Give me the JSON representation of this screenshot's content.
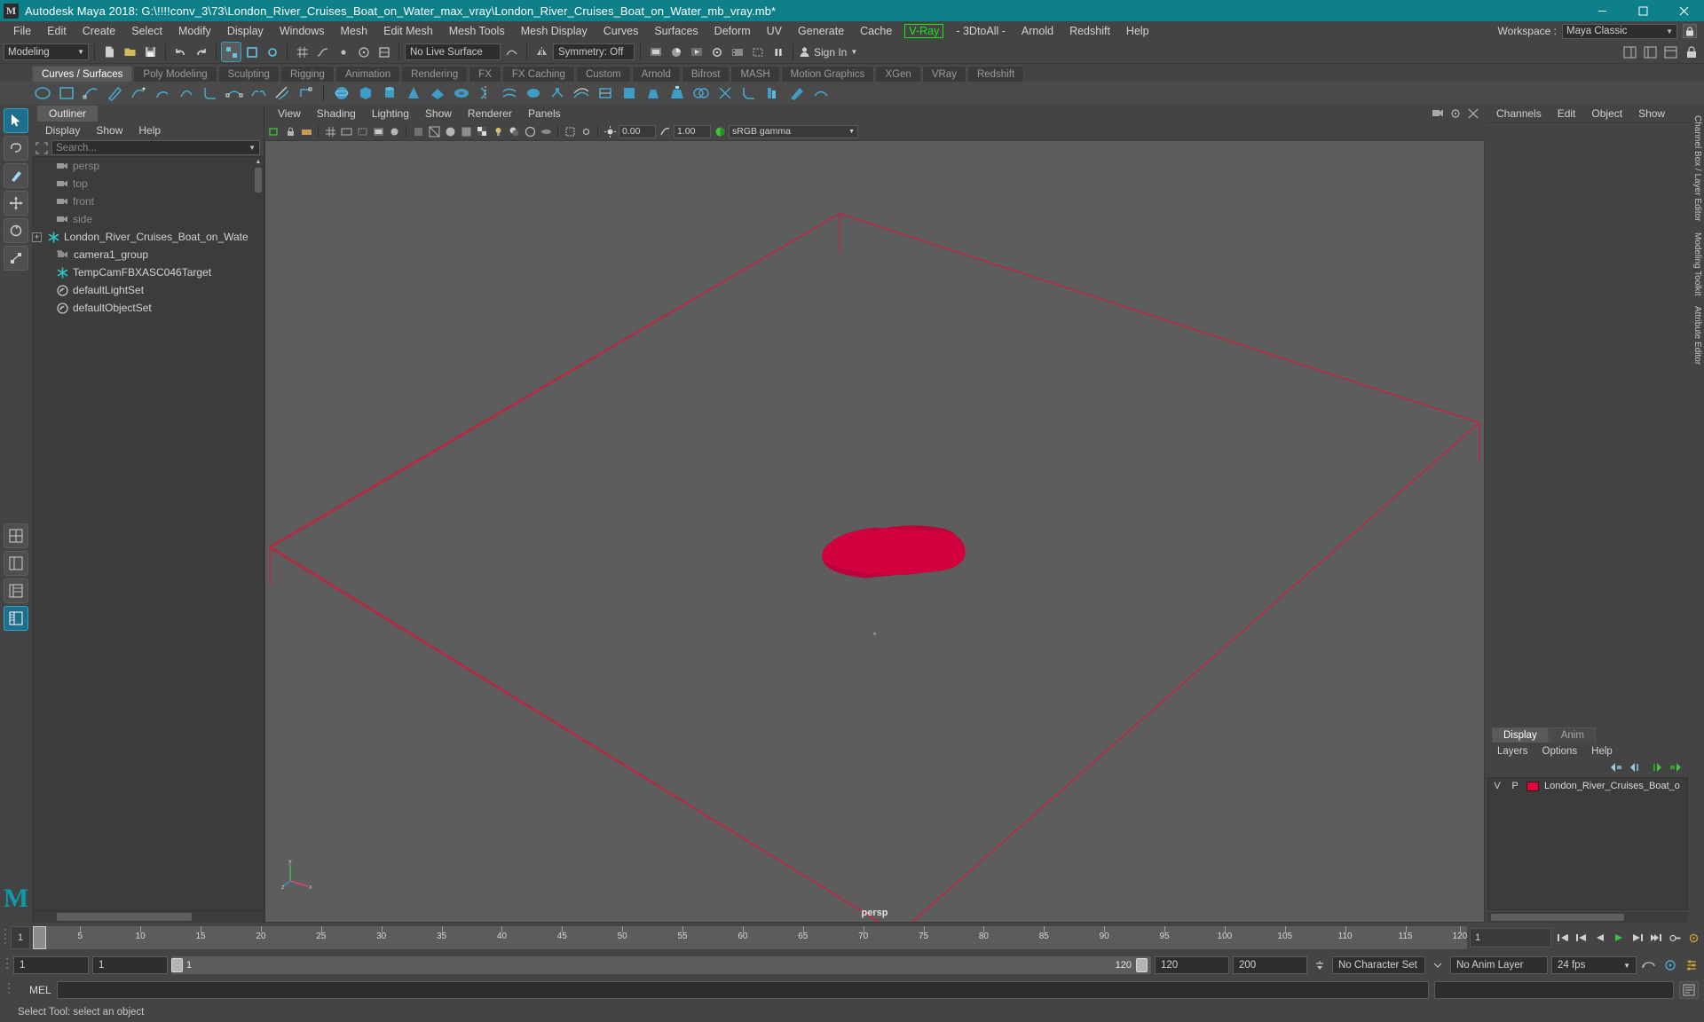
{
  "window": {
    "title": "Autodesk Maya 2018: G:\\!!!!conv_3\\73\\London_River_Cruises_Boat_on_Water_max_vray\\London_River_Cruises_Boat_on_Water_mb_vray.mb*",
    "logo": "M",
    "minimize": "minimize-icon",
    "maximize": "maximize-icon",
    "close": "close-icon"
  },
  "menubar": {
    "items": [
      {
        "label": "File"
      },
      {
        "label": "Edit"
      },
      {
        "label": "Create"
      },
      {
        "label": "Select"
      },
      {
        "label": "Modify"
      },
      {
        "label": "Display"
      },
      {
        "label": "Windows"
      },
      {
        "label": "Mesh"
      },
      {
        "label": "Edit Mesh"
      },
      {
        "label": "Mesh Tools"
      },
      {
        "label": "Mesh Display"
      },
      {
        "label": "Curves"
      },
      {
        "label": "Surfaces"
      },
      {
        "label": "Deform"
      },
      {
        "label": "UV"
      },
      {
        "label": "Generate"
      },
      {
        "label": "Cache"
      },
      {
        "label": "V-Ray"
      },
      {
        "label": "- 3DtoAll -"
      },
      {
        "label": "Arnold"
      },
      {
        "label": "Redshift"
      },
      {
        "label": "Help"
      }
    ],
    "workspace_label": "Workspace :",
    "workspace_value": "Maya Classic",
    "vray_color": "#19e619"
  },
  "statusline": {
    "mode": "Modeling",
    "live_surface": "No Live Surface",
    "symmetry": "Symmetry: Off",
    "signin": "Sign In"
  },
  "shelf": {
    "tabs": [
      "Curves / Surfaces",
      "Poly Modeling",
      "Sculpting",
      "Rigging",
      "Animation",
      "Rendering",
      "FX",
      "FX Caching",
      "Custom",
      "Arnold",
      "Bifrost",
      "MASH",
      "Motion Graphics",
      "XGen",
      "VRay",
      "Redshift"
    ],
    "active_tab": "Curves / Surfaces"
  },
  "outliner": {
    "tab": "Outliner",
    "menus": [
      "Display",
      "Show",
      "Help"
    ],
    "search_placeholder": "Search...",
    "items": [
      {
        "label": "persp",
        "icon": "camera-icon",
        "dim": true,
        "expandable": false
      },
      {
        "label": "top",
        "icon": "camera-icon",
        "dim": true,
        "expandable": false
      },
      {
        "label": "front",
        "icon": "camera-icon",
        "dim": true,
        "expandable": false
      },
      {
        "label": "side",
        "icon": "camera-icon",
        "dim": true,
        "expandable": false
      },
      {
        "label": "London_River_Cruises_Boat_on_Wate",
        "icon": "transform-icon",
        "dim": false,
        "expandable": true
      },
      {
        "label": "camera1_group",
        "icon": "camera-group-icon",
        "dim": false,
        "expandable": false
      },
      {
        "label": "TempCamFBXASC046Target",
        "icon": "transform-icon",
        "dim": false,
        "expandable": false
      },
      {
        "label": "defaultLightSet",
        "icon": "set-icon",
        "dim": false,
        "expandable": false
      },
      {
        "label": "defaultObjectSet",
        "icon": "set-icon",
        "dim": false,
        "expandable": false
      }
    ]
  },
  "viewport": {
    "menus": [
      "View",
      "Shading",
      "Lighting",
      "Show",
      "Renderer",
      "Panels"
    ],
    "exposure": "0.00",
    "gamma_value": "1.00",
    "color_management": "sRGB gamma",
    "camera_label": "persp",
    "axis": {
      "x": "x",
      "y": "y",
      "z": "z"
    },
    "object_color": "#d1003f",
    "wireframe_color": "#c0243f",
    "background_color": "#5d5d5d"
  },
  "right_panel": {
    "tabs": [
      "Channels",
      "Edit",
      "Object",
      "Show"
    ],
    "vertical_tabs": [
      "Channel Box / Layer Editor",
      "Modeling Toolkit",
      "Attribute Editor"
    ],
    "layer_tabs": [
      "Display",
      "Anim"
    ],
    "layer_active_tab": "Display",
    "layer_menus": [
      "Layers",
      "Options",
      "Help"
    ],
    "layers": [
      {
        "v": "V",
        "p": "P",
        "color": "#e8003c",
        "name": "London_River_Cruises_Boat_o"
      }
    ],
    "layer_headers": {
      "v": "V",
      "p": "P"
    }
  },
  "timeslider": {
    "current_frame": "1",
    "start_visible": "1",
    "ticks": [
      {
        "value": "5",
        "pct": 3.3
      },
      {
        "value": "10",
        "pct": 7.5
      },
      {
        "value": "15",
        "pct": 11.7
      },
      {
        "value": "20",
        "pct": 15.9
      },
      {
        "value": "25",
        "pct": 20.1
      },
      {
        "value": "30",
        "pct": 24.3
      },
      {
        "value": "35",
        "pct": 28.5
      },
      {
        "value": "40",
        "pct": 32.7
      },
      {
        "value": "45",
        "pct": 36.9
      },
      {
        "value": "50",
        "pct": 41.1
      },
      {
        "value": "55",
        "pct": 45.3
      },
      {
        "value": "60",
        "pct": 49.5
      },
      {
        "value": "65",
        "pct": 53.7
      },
      {
        "value": "70",
        "pct": 57.9
      },
      {
        "value": "75",
        "pct": 62.1
      },
      {
        "value": "80",
        "pct": 66.3
      },
      {
        "value": "85",
        "pct": 70.5
      },
      {
        "value": "90",
        "pct": 74.7
      },
      {
        "value": "95",
        "pct": 78.9
      },
      {
        "value": "100",
        "pct": 83.1
      },
      {
        "value": "105",
        "pct": 87.3
      },
      {
        "value": "110",
        "pct": 91.5
      },
      {
        "value": "115",
        "pct": 95.7
      },
      {
        "value": "120",
        "pct": 99.5
      }
    ],
    "frame_field": "1",
    "fps_playback": "24 fps"
  },
  "rangeslider": {
    "range_start": "1",
    "anim_start": "1",
    "slider_start_label": "1",
    "slider_end_label": "120",
    "anim_end": "120",
    "range_end": "200",
    "character_set": "No Character Set",
    "anim_layer": "No Anim Layer",
    "fps": "24 fps"
  },
  "commandline": {
    "language": "MEL",
    "input_value": "",
    "output_value": ""
  },
  "helpline": {
    "text": "Select Tool: select an object"
  }
}
